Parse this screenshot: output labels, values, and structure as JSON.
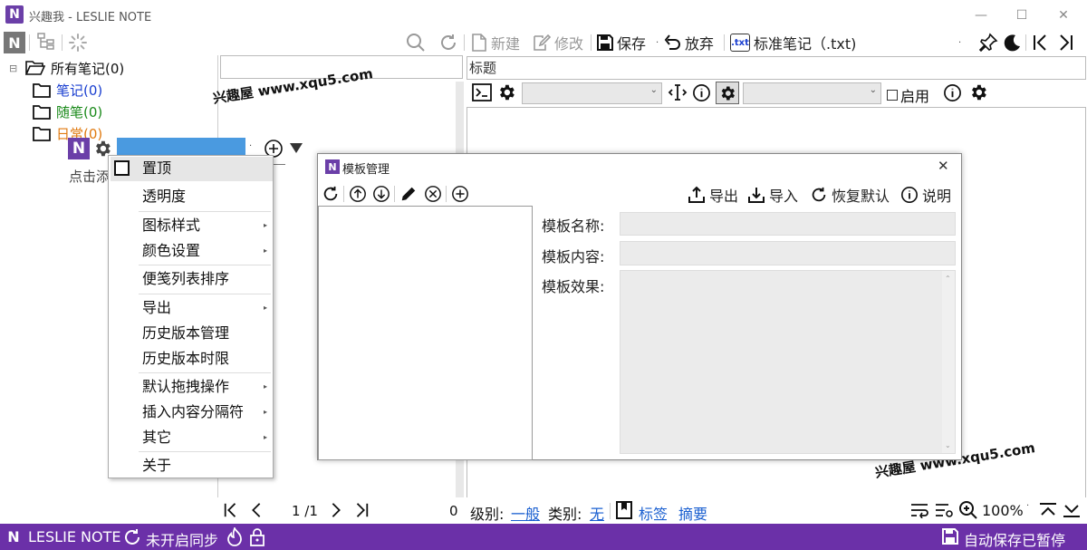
{
  "window": {
    "title": "兴趣我 - LESLIE NOTE",
    "logo": "N",
    "controls": [
      "—",
      "☐",
      "✕"
    ]
  },
  "toolbar": {
    "new_label": "新建",
    "edit_label": "修改",
    "save_label": "保存",
    "discard_label": "放弃",
    "txt_badge": ".txt",
    "note_type_label": "标准笔记（.txt)"
  },
  "tree": {
    "root": "所有笔记(0)",
    "items": [
      {
        "label": "笔记(0)",
        "color": "#1a3fd0"
      },
      {
        "label": "随笔(0)",
        "color": "#1a8a1a"
      },
      {
        "label": "日常(0)",
        "color": "#e07a10"
      }
    ],
    "hint": "点击添"
  },
  "editor": {
    "title_placeholder": "标题",
    "enable_label": "启用"
  },
  "watermark": {
    "text1": "兴趣屋 www.xqu5.com",
    "text2": "兴趣屋 www.xqu5.com"
  },
  "context_menu": {
    "items": [
      {
        "label": "置顶",
        "has_sub": false
      },
      {
        "label": "透明度",
        "has_sub": false
      },
      {
        "label": "图标样式",
        "has_sub": true
      },
      {
        "label": "颜色设置",
        "has_sub": true
      },
      {
        "label": "便笺列表排序",
        "has_sub": false
      },
      {
        "label": "导出",
        "has_sub": true
      },
      {
        "label": "历史版本管理",
        "has_sub": false
      },
      {
        "label": "历史版本时限",
        "has_sub": false
      },
      {
        "label": "默认拖拽操作",
        "has_sub": true
      },
      {
        "label": "插入内容分隔符",
        "has_sub": true
      },
      {
        "label": "其它",
        "has_sub": true
      },
      {
        "label": "关于",
        "has_sub": false
      }
    ],
    "arrow": "▸"
  },
  "template_dialog": {
    "title": "模板管理",
    "export_label": "导出",
    "import_label": "导入",
    "reset_label": "恢复默认",
    "help_label": "说明",
    "name_label": "模板名称:",
    "content_label": "模板内容:",
    "effect_label": "模板效果:"
  },
  "bottom": {
    "page_indicator": "1 /1",
    "count": "0",
    "level_label": "级别:",
    "level_value": "一般",
    "category_label": "类别:",
    "category_value": "无",
    "tag_label": "标签",
    "summary_label": "摘要",
    "zoom": "100%"
  },
  "status": {
    "app_name": "LESLIE NOTE",
    "sync_status": "未开启同步",
    "autosave_status": "自动保存已暂停"
  },
  "colors": {
    "accent": "#6b30a8",
    "link": "#1a5fd0",
    "selection": "#4a9ae0"
  }
}
